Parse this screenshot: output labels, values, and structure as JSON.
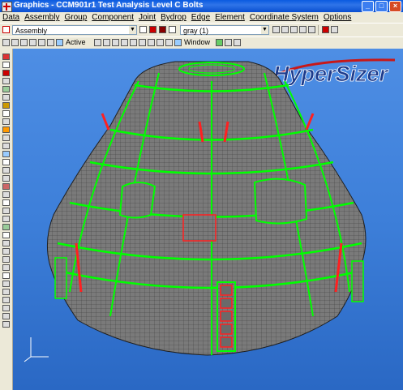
{
  "window": {
    "title": "Graphics - CCM901r1 Test Analysis Level C Bolts",
    "buttons": [
      "_",
      "□",
      "×"
    ]
  },
  "menu": [
    "Data",
    "Assembly",
    "Group",
    "Component",
    "Joint",
    "Bydrop",
    "Edge",
    "Element",
    "Coordinate System",
    "Options"
  ],
  "toolbar1": {
    "assembly_value": "Assembly",
    "color_value": "gray (1)"
  },
  "toolbar2": {
    "active_label": "Active",
    "window_label": "Window"
  },
  "viewport": {
    "logo_text": "HyperSizer",
    "background_color": "#3d7fd9",
    "mesh_colors": {
      "shell": "#7a7a7a",
      "panel_outline": "#00ff00",
      "bolt_edge": "#ff2020"
    }
  }
}
